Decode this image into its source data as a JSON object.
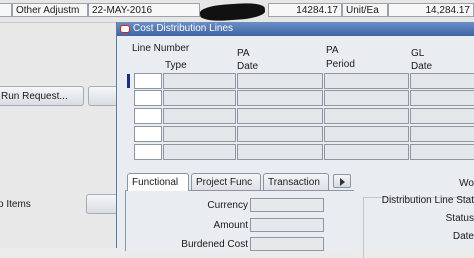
{
  "background": {
    "row": {
      "field1": "Other Adjustm",
      "date": "22-MAY-2016",
      "amount1": "14284.17",
      "unit": "Unit/Ea",
      "amount2": "14,284.17"
    },
    "buttons": {
      "run_request": "Run Request...",
      "items": "o Items"
    }
  },
  "window": {
    "title": "Cost Distribution Lines"
  },
  "columns": {
    "line_number": "Line Number",
    "type": "Type",
    "pa_date": "PA\nDate",
    "pa_date_l1": "PA",
    "pa_date_l2": "Date",
    "pa_period_l1": "PA",
    "pa_period_l2": "Period",
    "gl_date_l1": "GL",
    "gl_date_l2": "Date"
  },
  "tabs": [
    "Functional",
    "Project Func",
    "Transaction"
  ],
  "functional_fields": {
    "currency": "Currency",
    "amount": "Amount",
    "burdened_cost": "Burdened Cost"
  },
  "right_fields": {
    "work": "Wo",
    "distribution_line_status": "Distribution Line Stat",
    "status": "Status",
    "date": "Date"
  },
  "colors": {
    "title_bar": "#3e64a4",
    "current_record": "#1d2f7a"
  }
}
